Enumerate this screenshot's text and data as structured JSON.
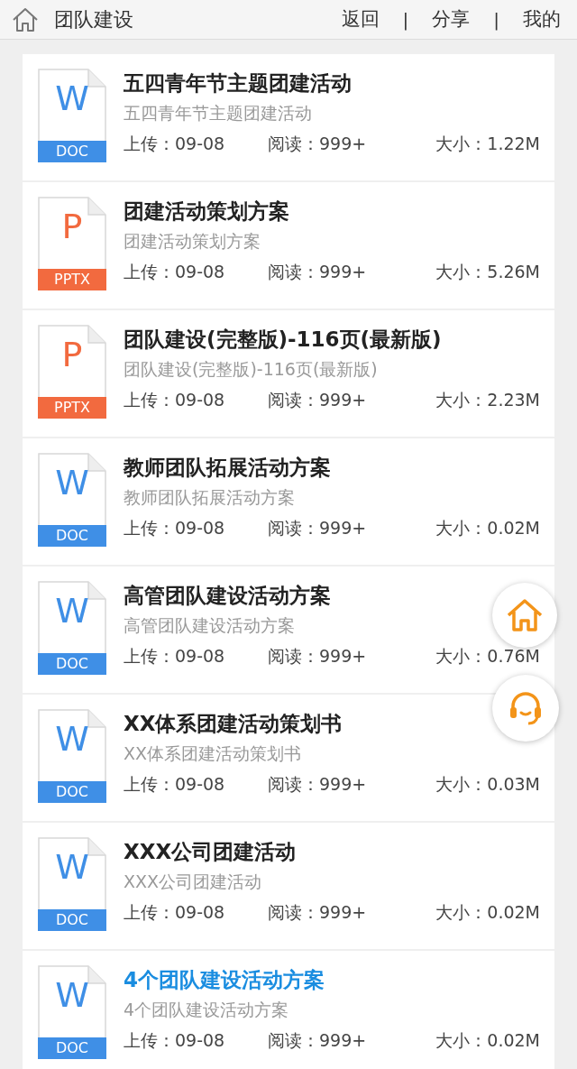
{
  "header": {
    "title": "团队建设",
    "links": [
      "返回",
      "|",
      "分享",
      "|",
      "我的"
    ]
  },
  "files": [
    {
      "kind": "doc",
      "letter": "W",
      "badge": "DOC",
      "title": "五四青年节主题团建活动",
      "subtitle": "五四青年节主题团建活动",
      "upload": "上传：09-08",
      "reads": "阅读：999+",
      "size": "大小：1.22M",
      "selected": false
    },
    {
      "kind": "pptx",
      "letter": "P",
      "badge": "PPTX",
      "title": "团建活动策划方案",
      "subtitle": "团建活动策划方案",
      "upload": "上传：09-08",
      "reads": "阅读：999+",
      "size": "大小：5.26M",
      "selected": false
    },
    {
      "kind": "pptx",
      "letter": "P",
      "badge": "PPTX",
      "title": "团队建设(完整版)-116页(最新版)",
      "subtitle": "团队建设(完整版)-116页(最新版)",
      "upload": "上传：09-08",
      "reads": "阅读：999+",
      "size": "大小：2.23M",
      "selected": false
    },
    {
      "kind": "doc",
      "letter": "W",
      "badge": "DOC",
      "title": "教师团队拓展活动方案",
      "subtitle": "教师团队拓展活动方案",
      "upload": "上传：09-08",
      "reads": "阅读：999+",
      "size": "大小：0.02M",
      "selected": false
    },
    {
      "kind": "doc",
      "letter": "W",
      "badge": "DOC",
      "title": "高管团队建设活动方案",
      "subtitle": "高管团队建设活动方案",
      "upload": "上传：09-08",
      "reads": "阅读：999+",
      "size": "大小：0.76M",
      "selected": false
    },
    {
      "kind": "doc",
      "letter": "W",
      "badge": "DOC",
      "title": "XX体系团建活动策划书",
      "subtitle": "XX体系团建活动策划书",
      "upload": "上传：09-08",
      "reads": "阅读：999+",
      "size": "大小：0.03M",
      "selected": false
    },
    {
      "kind": "doc",
      "letter": "W",
      "badge": "DOC",
      "title": "XXX公司团建活动",
      "subtitle": "XXX公司团建活动",
      "upload": "上传：09-08",
      "reads": "阅读：999+",
      "size": "大小：0.02M",
      "selected": false
    },
    {
      "kind": "doc",
      "letter": "W",
      "badge": "DOC",
      "title": "4个团队建设活动方案",
      "subtitle": "4个团队建设活动方案",
      "upload": "上传：09-08",
      "reads": "阅读：999+",
      "size": "大小：0.02M",
      "selected": true
    }
  ]
}
